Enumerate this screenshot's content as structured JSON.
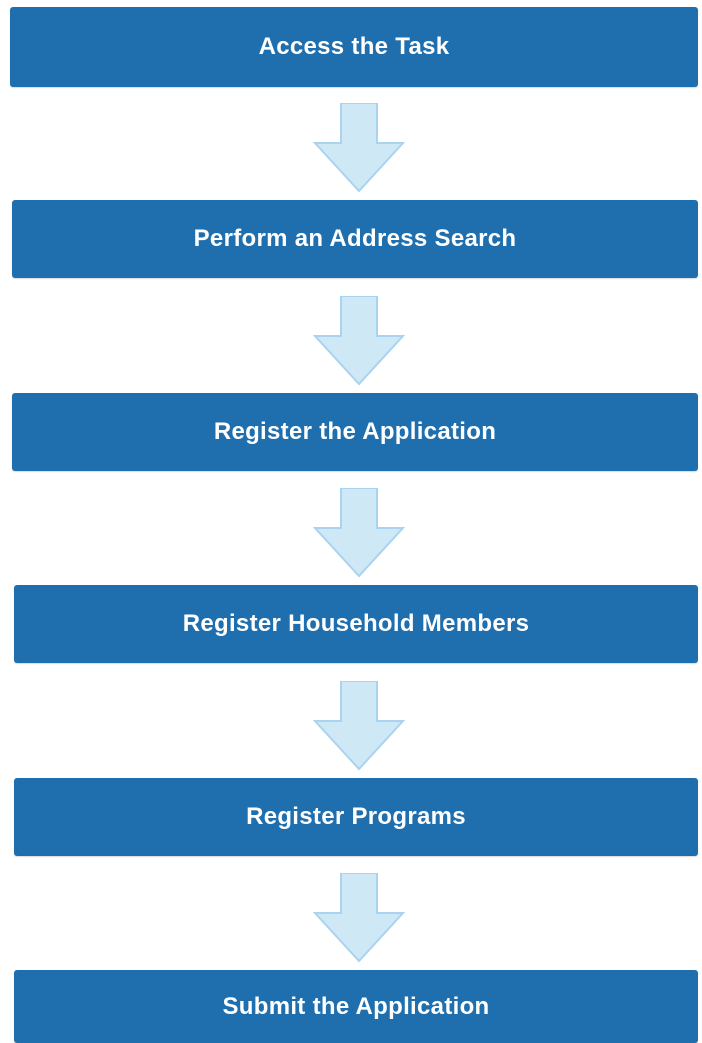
{
  "steps": [
    {
      "label": "Access the Task"
    },
    {
      "label": "Perform an Address Search"
    },
    {
      "label": "Register the Application"
    },
    {
      "label": "Register Household Members"
    },
    {
      "label": "Register Programs"
    },
    {
      "label": "Submit the Application"
    }
  ],
  "colors": {
    "step_fill": "#1f6fae",
    "step_text": "#ffffff",
    "arrow_fill": "#cfe8f6",
    "arrow_stroke": "#a9d3ee"
  },
  "icons": {
    "connector": "arrow-down-icon"
  }
}
